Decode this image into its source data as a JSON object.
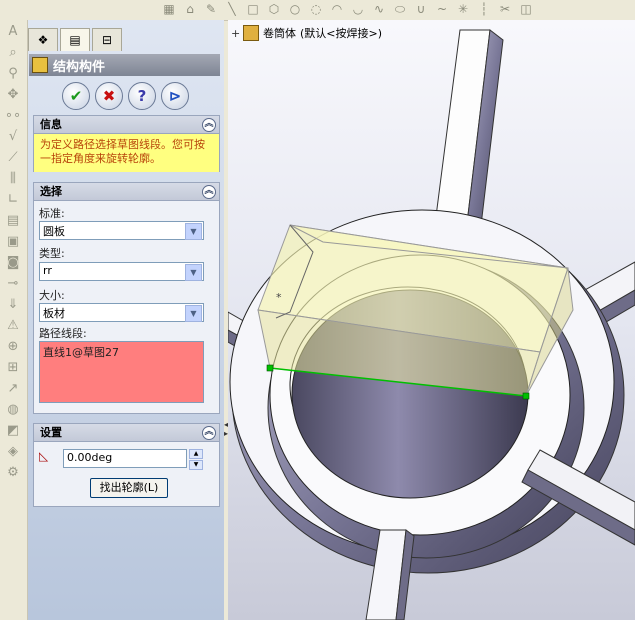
{
  "feature_panel": {
    "title": "结构构件",
    "buttons": {
      "ok": "✔",
      "cancel": "✖",
      "help": "?",
      "pin": "⊳"
    },
    "tab_icons": [
      "feature-manager-tab",
      "property-manager-tab",
      "configuration-manager-tab"
    ]
  },
  "info": {
    "header": "信息",
    "message": "为定义路径选择草图线段。您可按一指定角度来旋转轮廓。"
  },
  "selection": {
    "header": "选择",
    "standard_label": "标准:",
    "standard_value": "圆板",
    "type_label": "类型:",
    "type_value": "rr",
    "size_label": "大小:",
    "size_value": "板材",
    "path_label": "路径线段:",
    "path_items": [
      "直线1@草图27"
    ]
  },
  "settings": {
    "header": "设置",
    "angle_value": "0.00deg",
    "find_profile_button": "找出轮廓(L)"
  },
  "viewport": {
    "tree_part": "卷筒体",
    "tree_config": "(默认<按焊接>)"
  },
  "colors": {
    "info_bg": "#ffff80",
    "path_box_bg": "#ff7e7e",
    "highlight_line": "#00c000"
  }
}
